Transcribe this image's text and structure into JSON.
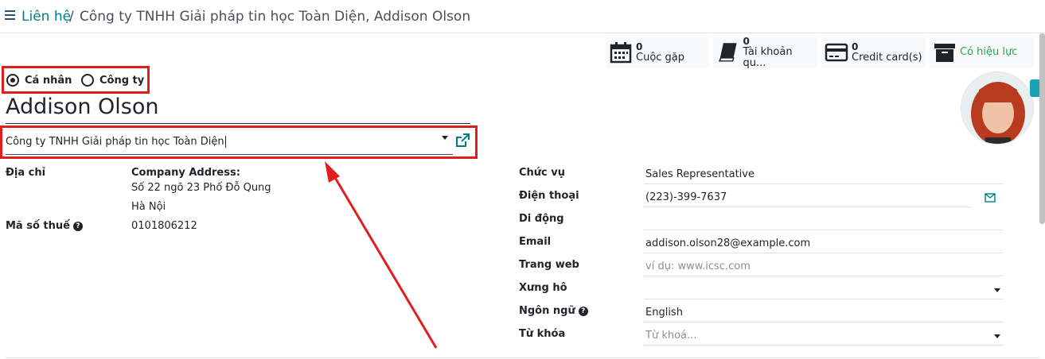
{
  "breadcrumb": {
    "parent": "Liên hệ",
    "separator": "/",
    "current": "Công ty TNHH Giải pháp tin học Toàn Diện, Addison Olson"
  },
  "smart_buttons": [
    {
      "count": "0",
      "label": "Cuộc gặp",
      "icon": "calendar-icon"
    },
    {
      "count": "0",
      "label": "Tài khoản qu...",
      "icon": "book-icon"
    },
    {
      "count": "0",
      "label": "Credit card(s)",
      "icon": "credit-card-icon"
    },
    {
      "label": "Có hiệu lực",
      "icon": "archive-icon",
      "color": "#28a745"
    }
  ],
  "type_radio": {
    "individual": "Cá nhân",
    "company": "Công ty",
    "selected": "Cá nhân"
  },
  "contact": {
    "name": "Addison Olson",
    "company": "Công ty TNHH Giải pháp tin học Toàn Diện"
  },
  "left_fields": {
    "address_label": "Địa chỉ",
    "address_title": "Company Address:",
    "address_line1": "Số 22 ngõ 23 Phố Đỗ Qung",
    "address_line2": "Hà Nội",
    "tax_label": "Mã số thuế",
    "tax_value": "0101806212",
    "help_glyph": "?"
  },
  "right_fields": {
    "job_label": "Chức vụ",
    "job_value": "Sales Representative",
    "phone_label": "Điện thoại",
    "phone_value": "(223)-399-7637",
    "mobile_label": "Di động",
    "mobile_value": "",
    "email_label": "Email",
    "email_value": "addison.olson28@example.com",
    "website_label": "Trang web",
    "website_placeholder": "ví dụ: www.icsc.com",
    "title_label": "Xưng hô",
    "title_value": "",
    "lang_label": "Ngôn ngữ",
    "lang_value": "English",
    "tags_label": "Từ khóa",
    "tags_placeholder": "Từ khoá..."
  },
  "colors": {
    "accent": "#017e84",
    "highlight": "#e11d1d",
    "active": "#28a745"
  }
}
